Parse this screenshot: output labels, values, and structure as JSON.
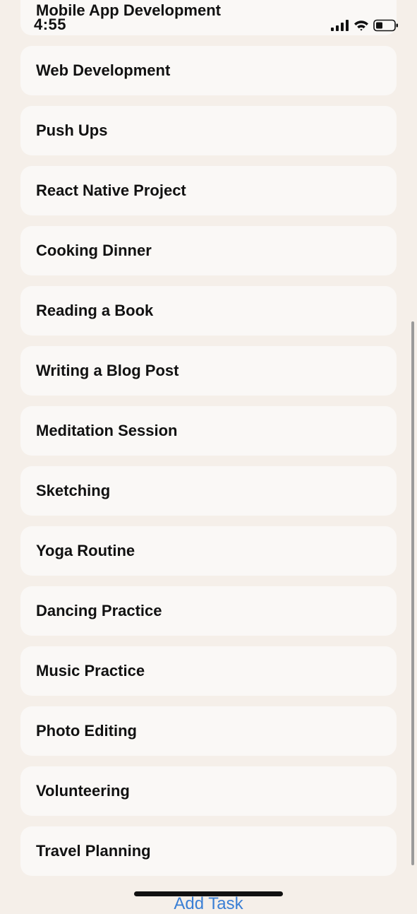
{
  "status_bar": {
    "time": "4:55"
  },
  "tasks": [
    "Mobile App Development",
    "Web Development",
    "Push Ups",
    "React Native Project",
    "Cooking Dinner",
    "Reading a Book",
    "Writing a Blog Post",
    "Meditation Session",
    "Sketching",
    "Yoga Routine",
    "Dancing Practice",
    "Music Practice",
    "Photo Editing",
    "Volunteering",
    "Travel Planning"
  ],
  "footer": {
    "add_task_label": "Add Task"
  },
  "colors": {
    "background": "#f5efe9",
    "card": "#faf8f6",
    "link": "#3a7fd5"
  }
}
